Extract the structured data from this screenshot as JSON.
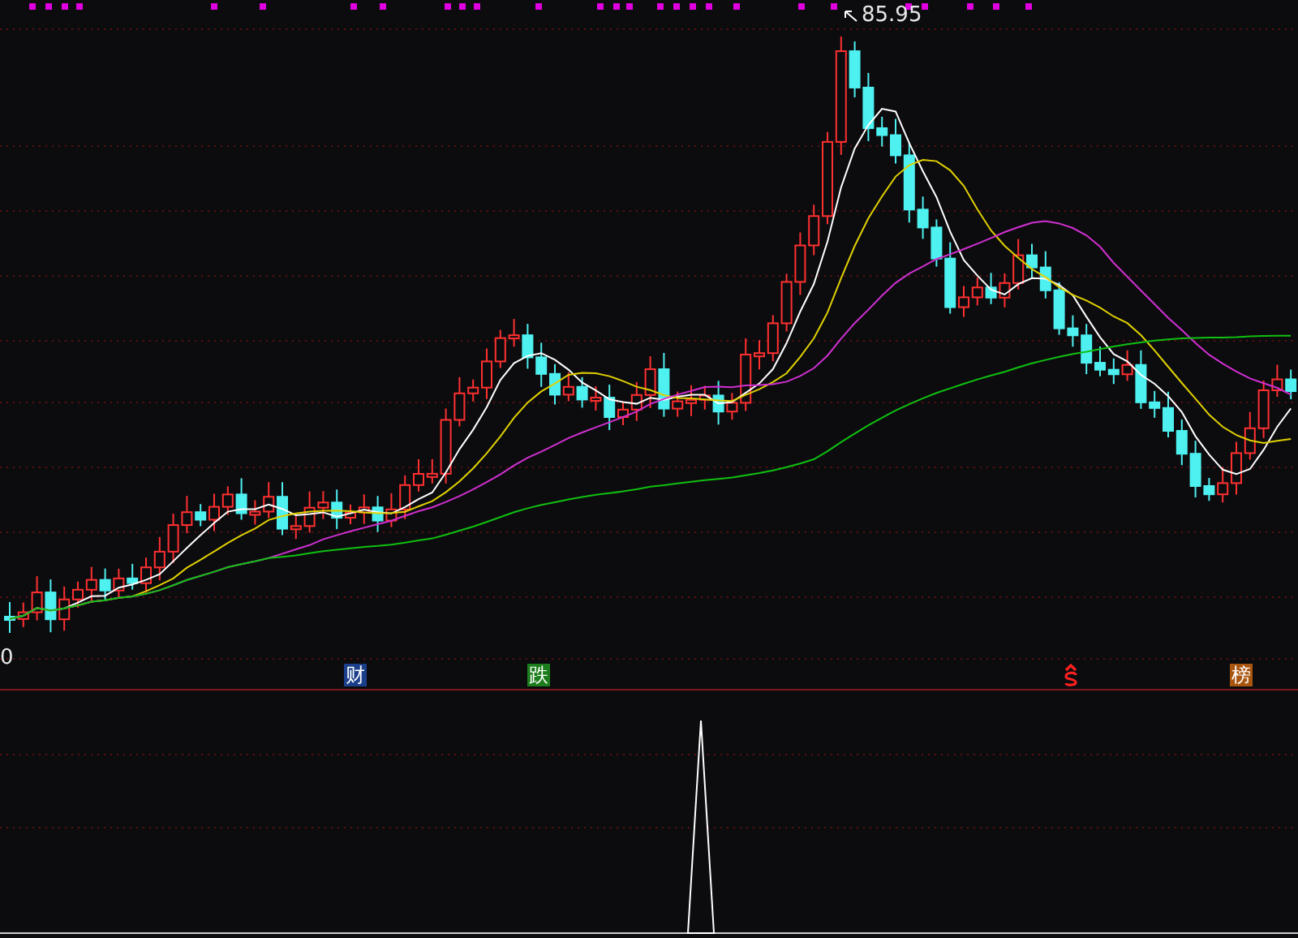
{
  "chart": {
    "high_label": "85.95",
    "edge_label": "0"
  },
  "markers": [
    {
      "kind": "text",
      "label": "财",
      "color": "#1c3f8c"
    },
    {
      "kind": "text",
      "label": "跌",
      "color": "#1b7d1b"
    },
    {
      "kind": "icon",
      "color": "#ff2020"
    },
    {
      "kind": "text",
      "label": "榜",
      "color": "#a8560f"
    }
  ]
}
